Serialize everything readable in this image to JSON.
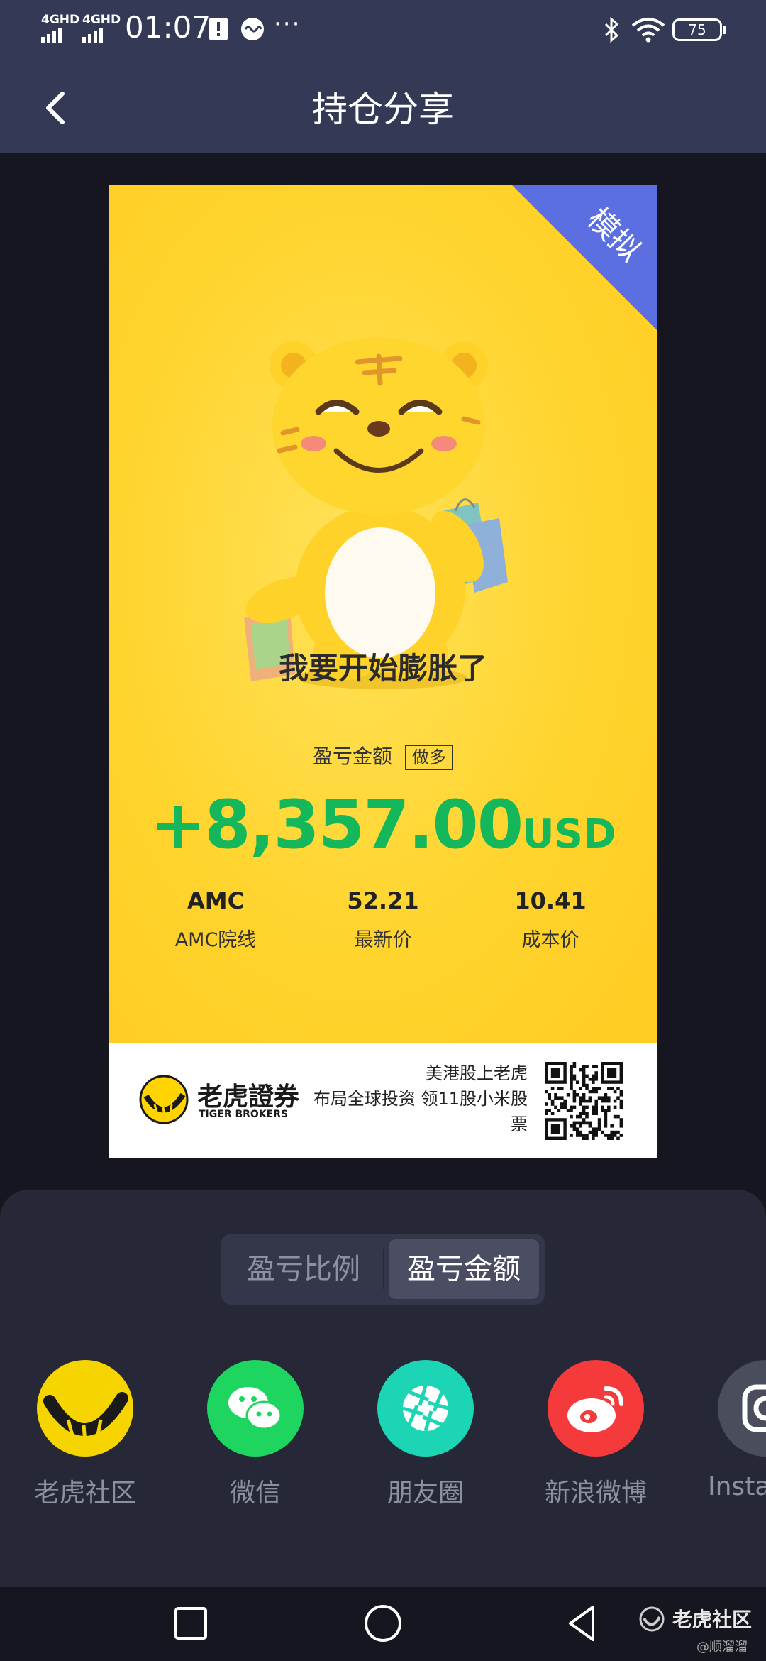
{
  "status_bar": {
    "network1": "4GHD",
    "network2": "4GHD",
    "time": "01:07",
    "more": "···",
    "battery": "75"
  },
  "header": {
    "title": "持仓分享"
  },
  "poster": {
    "corner_badge": "模拟",
    "slogan": "我要开始膨胀了",
    "pnl_label": "盈亏金额",
    "pnl_tag": "做多",
    "amount": "+8,357.00",
    "currency": "USD",
    "stats": [
      {
        "value": "AMC",
        "label": "AMC院线"
      },
      {
        "value": "52.21",
        "label": "最新价"
      },
      {
        "value": "10.41",
        "label": "成本价"
      }
    ],
    "brand_cn": "老虎證券",
    "brand_en": "TIGER BROKERS",
    "promo_line1": "美港股上老虎",
    "promo_line2": "布局全球投资 领11股小米股",
    "promo_line3": "票"
  },
  "toggle": {
    "option1": "盈亏比例",
    "option2": "盈亏金额",
    "selected": "盈亏金额"
  },
  "share_targets": [
    {
      "label": "老虎社区",
      "icon": "tiger-community-icon",
      "color": "#f5d400"
    },
    {
      "label": "微信",
      "icon": "wechat-icon",
      "color": "#1ed65f"
    },
    {
      "label": "朋友圈",
      "icon": "moments-icon",
      "color": "#1bd5b4"
    },
    {
      "label": "新浪微博",
      "icon": "weibo-icon",
      "color": "#f43a3a"
    },
    {
      "label": "Insta",
      "icon": "instagram-icon",
      "color": "#4a4d5c"
    }
  ],
  "watermark": {
    "main": "老虎社区",
    "sub": "@顺溜溜"
  },
  "colors": {
    "header_bg": "#343955",
    "poster_yellow": "#ffd02e",
    "profit_green": "#14b85a",
    "badge_blue": "#5b6fe0"
  }
}
